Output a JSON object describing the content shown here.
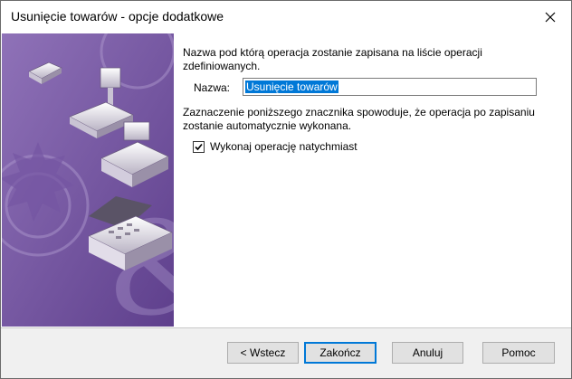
{
  "window": {
    "title": "Usunięcie towarów - opcje dodatkowe",
    "close_icon": "close-icon"
  },
  "form": {
    "description": "Nazwa pod którą operacja zostanie zapisana na liście operacji zdefiniowanych.",
    "name_label": "Nazwa:",
    "name_value": "Usunięcie towarów",
    "checkbox_description": "Zaznaczenie poniższego znacznika spowoduje, że operacja po zapisaniu zostanie automatycznie wykonana.",
    "checkbox_label": "Wykonaj operację natychmiast",
    "checkbox_checked": true
  },
  "buttons": {
    "back": "< Wstecz",
    "finish": "Zakończ",
    "cancel": "Anuluj",
    "help": "Pomoc"
  },
  "colors": {
    "side_panel": "#7b5aa6",
    "selection": "#0078d7"
  }
}
